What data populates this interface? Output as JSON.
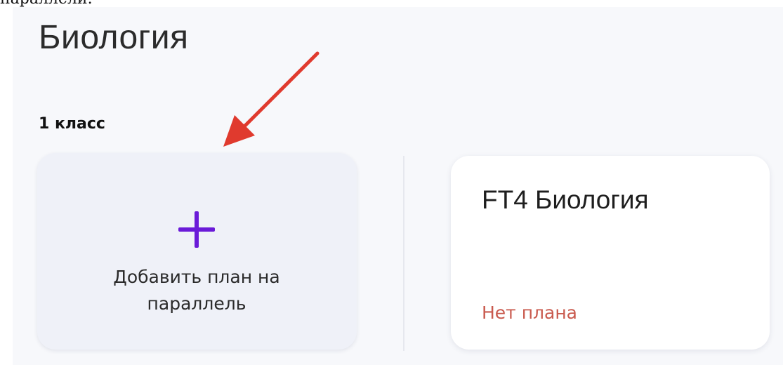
{
  "cropped_top_text": "параллели.",
  "page": {
    "title": "Биология"
  },
  "grade": {
    "heading": "1 класс"
  },
  "add_plan_card": {
    "icon": "plus-icon",
    "label_line1": "Добавить план на",
    "label_line2": "параллель"
  },
  "plan_card": {
    "title": "FT4 Биология",
    "status": "Нет плана"
  },
  "colors": {
    "accent": "#6a1ad8",
    "annotation_arrow": "#e03a2e",
    "status_no_plan": "#c95a4e"
  }
}
